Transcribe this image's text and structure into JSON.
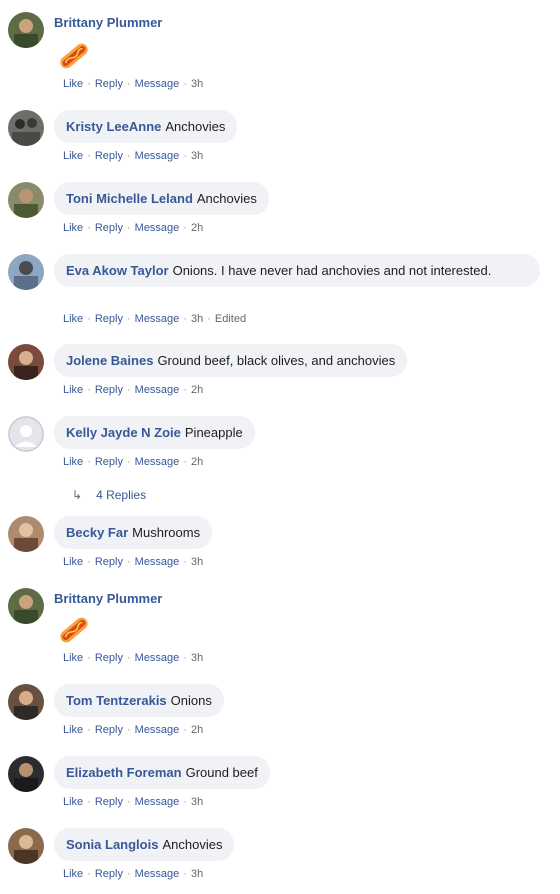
{
  "actions": {
    "like": "Like",
    "reply": "Reply",
    "message": "Message",
    "edited": "Edited"
  },
  "comments": [
    {
      "author": "Brittany Plummer",
      "text": "",
      "time": "3h",
      "has_sticker": true
    },
    {
      "author": "Kristy LeeAnne",
      "text": "Anchovies",
      "time": "3h"
    },
    {
      "author": "Toni Michelle Leland",
      "text": "Anchovies",
      "time": "2h"
    },
    {
      "author": "Eva Akow Taylor",
      "text": "Onions. I have never had anchovies and not interested.",
      "time": "3h",
      "edited": true
    },
    {
      "author": "Jolene Baines",
      "text": "Ground beef, black olives, and anchovies",
      "time": "2h"
    },
    {
      "author": "Kelly Jayde N Zoie",
      "text": "Pineapple",
      "time": "2h"
    },
    {
      "author": "Becky Far",
      "text": "Mushrooms",
      "time": "3h"
    },
    {
      "author": "Brittany Plummer",
      "text": "",
      "time": "3h",
      "has_sticker": true
    },
    {
      "author": "Tom Tentzerakis",
      "text": "Onions",
      "time": "2h"
    },
    {
      "author": "Elizabeth Foreman",
      "text": "Ground beef",
      "time": "3h"
    },
    {
      "author": "Sonia Langlois",
      "text": "Anchovies",
      "time": "3h"
    }
  ],
  "replies_label": "4 Replies",
  "colors": {
    "link": "#385898",
    "bubble": "#f0f2f5",
    "meta": "#606770",
    "sticker": "#f26a21"
  },
  "icons": {
    "sticker": "hot-dog-sticker",
    "reply_arrow": "reply-arrow-icon",
    "avatar": "user-avatar"
  }
}
